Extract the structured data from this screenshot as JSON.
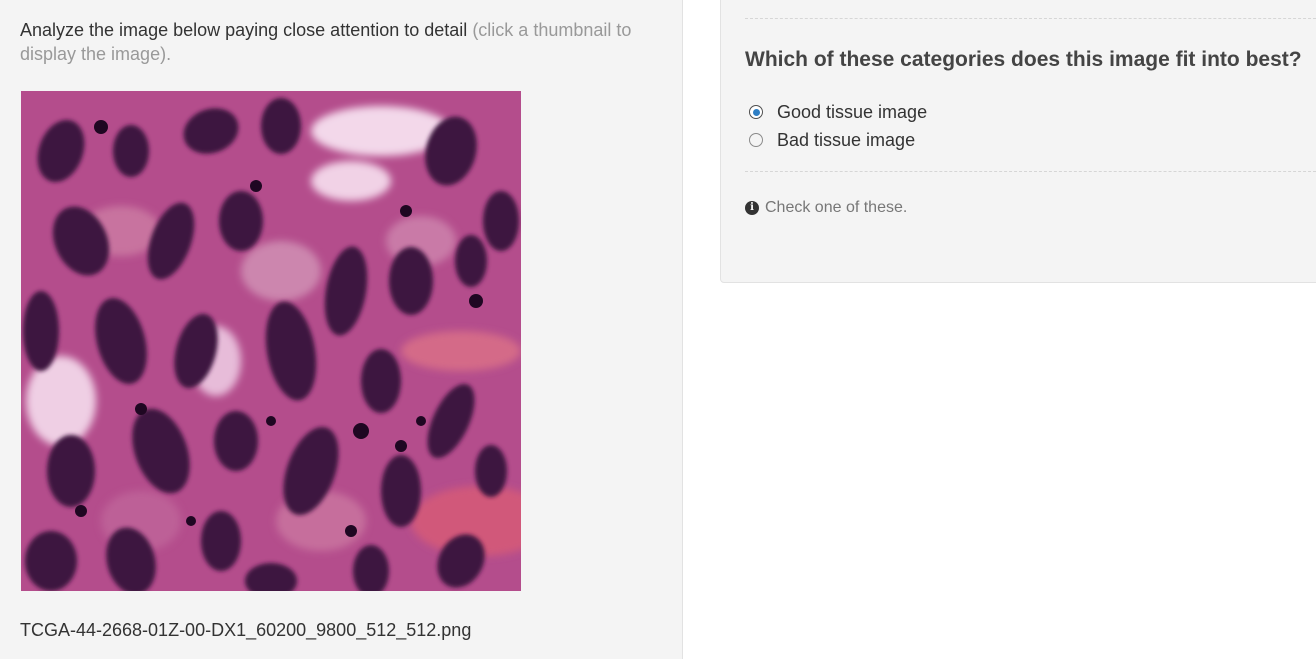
{
  "instruction": {
    "main": "Analyze the image below paying close attention to detail",
    "hint": "(click a thumbnail to display the image)."
  },
  "image": {
    "filename": "TCGA-44-2668-01Z-00-DX1_60200_9800_512_512.png"
  },
  "question": {
    "title": "Which of these categories does this image fit into best?",
    "options": [
      {
        "label": "Good tissue image",
        "selected": true
      },
      {
        "label": "Bad tissue image",
        "selected": false
      }
    ],
    "help_text": "Check one of these.",
    "help_icon": "info-icon"
  },
  "colors": {
    "panel_bg": "#f4f4f4",
    "radio_accent": "#2d7ec4",
    "hint_text": "#999999"
  }
}
